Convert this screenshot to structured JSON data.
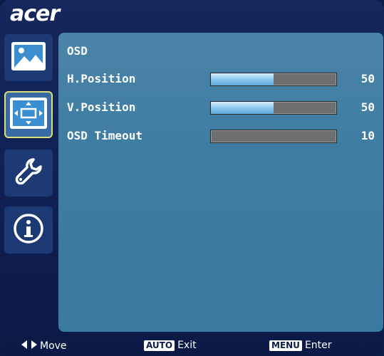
{
  "brand": {
    "logo_text": "acer"
  },
  "sidebar": {
    "items": [
      {
        "name": "picture",
        "icon": "picture-icon"
      },
      {
        "name": "osd",
        "icon": "osd-position-icon",
        "active": true
      },
      {
        "name": "settings",
        "icon": "wrench-icon"
      },
      {
        "name": "information",
        "icon": "info-icon"
      }
    ]
  },
  "panel": {
    "title": "OSD",
    "rows": [
      {
        "label": "H.Position",
        "value": "50",
        "level_percent": 50
      },
      {
        "label": "V.Position",
        "value": "50",
        "level_percent": 50
      },
      {
        "label": "OSD Timeout",
        "value": "10",
        "level_percent": 0
      }
    ]
  },
  "footer": {
    "move_label": "Move",
    "auto_key": "AUTO",
    "exit_label": "Exit",
    "menu_key": "MENU",
    "enter_label": "Enter"
  },
  "colors": {
    "frame": "#15275c",
    "panel": "#4b84a8",
    "active_border": "#d9e07a",
    "bar_fill": "#8cc8ef",
    "bar_track": "#6f6f6f"
  }
}
